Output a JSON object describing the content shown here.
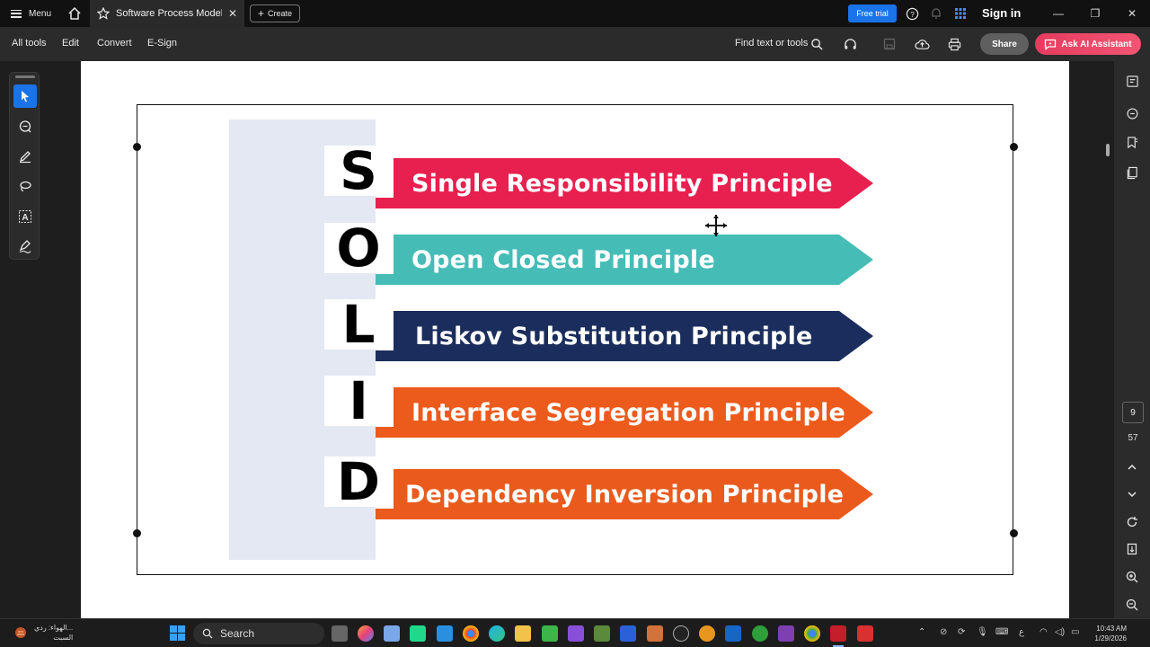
{
  "titlebar": {
    "menu_label": "Menu",
    "tab_title": "Software Process Models",
    "create_label": "Create",
    "free_trial_label": "Free trial",
    "sign_in_label": "Sign in"
  },
  "toolbar": {
    "menus": [
      "All tools",
      "Edit",
      "Convert",
      "E-Sign"
    ],
    "find_label": "Find text or tools",
    "share_label": "Share",
    "ai_label": "Ask AI Assistant"
  },
  "slide": {
    "rows": [
      {
        "letter": "S",
        "label": "Single Responsibility Principle",
        "color": "#e8204f"
      },
      {
        "letter": "O",
        "label": "Open Closed Principle",
        "color": "#45bdb6"
      },
      {
        "letter": "L",
        "label": "Liskov Substitution Principle",
        "color": "#1b2d5c"
      },
      {
        "letter": "I",
        "label": "Interface Segregation Principle",
        "color": "#ec5a1c"
      },
      {
        "letter": "D",
        "label": "Dependency Inversion Principle",
        "color": "#ea5a1d"
      }
    ]
  },
  "page_nav": {
    "current": "9",
    "total": "57"
  },
  "taskbar": {
    "weather_line1": "الهواء: ردي...",
    "weather_line2": "السبت",
    "search_label": "Search",
    "time": "10:43 AM",
    "date": "1/29/2026",
    "lang": "ع"
  },
  "colors": {
    "accent": "#1a73e8",
    "ai_button": "#e63b5e"
  }
}
